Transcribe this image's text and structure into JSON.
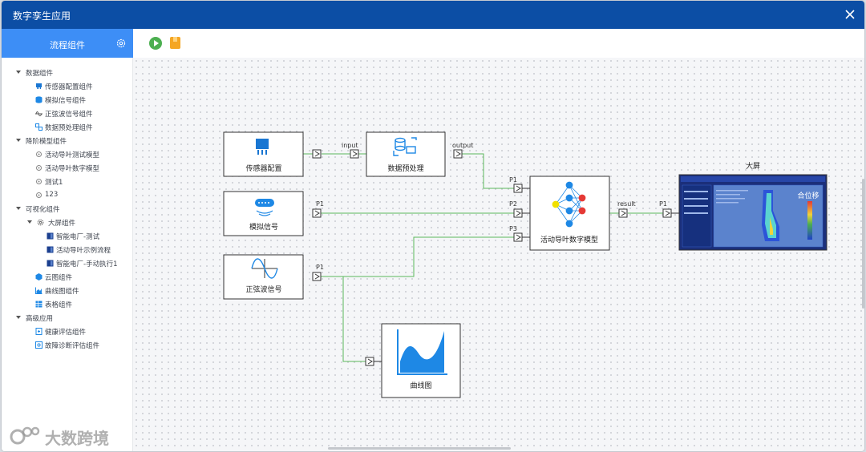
{
  "window": {
    "title": "数字孪生应用"
  },
  "sidebar": {
    "header": "流程组件",
    "tree": [
      {
        "label": "数据组件",
        "level": 0,
        "icon": "caret"
      },
      {
        "label": "传感器配置组件",
        "level": 1,
        "icon": "sensor-icon"
      },
      {
        "label": "模拟信号组件",
        "level": 1,
        "icon": "database-icon"
      },
      {
        "label": "正弦波信号组件",
        "level": 1,
        "icon": "wave-icon"
      },
      {
        "label": "数据预处理组件",
        "level": 1,
        "icon": "preprocess-icon"
      },
      {
        "label": "降阶模型组件",
        "level": 0,
        "icon": "caret"
      },
      {
        "label": "活动导叶测试模型",
        "level": 1,
        "icon": "model-icon"
      },
      {
        "label": "活动导叶数字模型",
        "level": 1,
        "icon": "model-icon"
      },
      {
        "label": "测试1",
        "level": 1,
        "icon": "model-icon"
      },
      {
        "label": "123",
        "level": 1,
        "icon": "model-icon"
      },
      {
        "label": "可视化组件",
        "level": 0,
        "icon": "caret"
      },
      {
        "label": "大屏组件",
        "level": 1,
        "icon": "caret-gear"
      },
      {
        "label": "智能电厂-测试",
        "level": 2,
        "icon": "screen-icon"
      },
      {
        "label": "活动导叶示例流程",
        "level": 2,
        "icon": "screen-icon"
      },
      {
        "label": "智能电厂-手动执行1",
        "level": 2,
        "icon": "screen-icon"
      },
      {
        "label": "云图组件",
        "level": 1,
        "icon": "cloud-icon"
      },
      {
        "label": "曲线图组件",
        "level": 1,
        "icon": "chart-icon"
      },
      {
        "label": "表格组件",
        "level": 1,
        "icon": "table-icon"
      },
      {
        "label": "高级应用",
        "level": 0,
        "icon": "caret"
      },
      {
        "label": "健康评估组件",
        "level": 1,
        "icon": "health-icon"
      },
      {
        "label": "故障诊断评估组件",
        "level": 1,
        "icon": "diagnosis-icon"
      }
    ]
  },
  "flow": {
    "nodes": {
      "sensor": "传感器配置",
      "preprocess": "数据预处理",
      "analog": "模拟信号",
      "sine": "正弦波信号",
      "model": "活动导叶数字模型",
      "curve": "曲线图",
      "screen": "大屏"
    },
    "ports": {
      "input": "input",
      "output": "output",
      "p1": "P1",
      "p2": "P2",
      "p3": "P3",
      "result": "result",
      "screen_p1": "P1",
      "analog_p1": "P1",
      "sine_p1": "P1"
    },
    "screen_label": "合位移",
    "colors": {
      "edge": "#5cb85c",
      "accent": "#2196f3",
      "title": "#0c4ea5"
    }
  },
  "watermark": "大数跨境"
}
